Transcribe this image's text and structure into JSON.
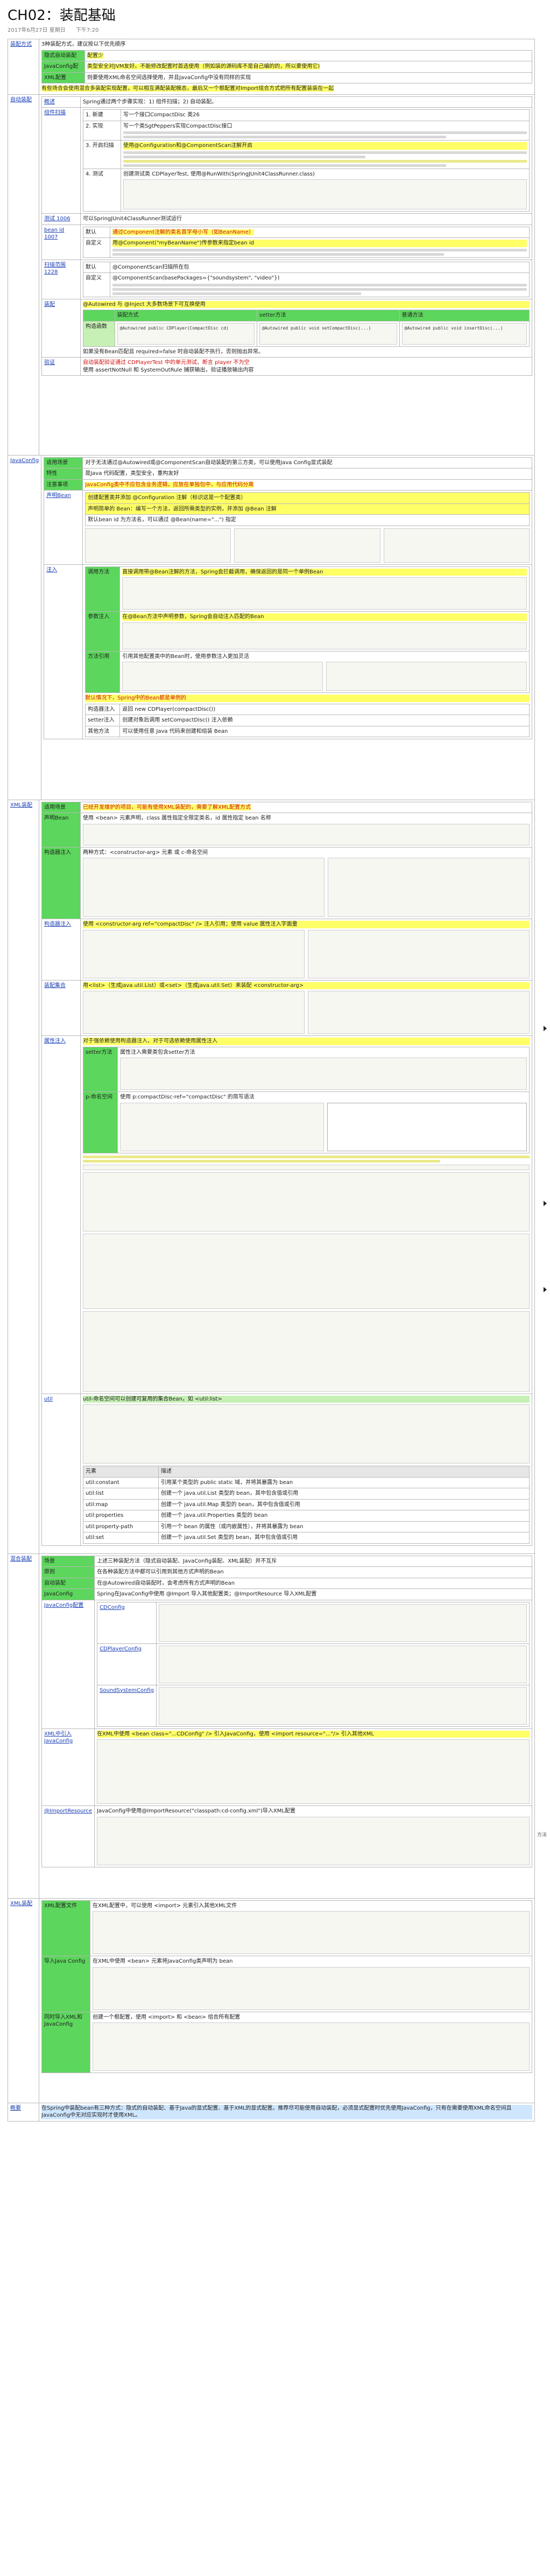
{
  "doc": {
    "title": "CH02：装配基础",
    "date": "2017年6月27日 星期日",
    "time": "下午7:20"
  },
  "sections": {
    "assembly": {
      "label": "装配方式",
      "intro": "3种装配方式，建议按以下优先顺序",
      "rows": [
        {
          "label": "隐式自动装配",
          "text": "配置少"
        },
        {
          "label": "JavaConfig配",
          "text": "类型安全对JVM友好。不能修改配置时首选使用（例如装的源码库不是自己编的的，所以要使用它)"
        },
        {
          "label": "XML配置",
          "text": "则要使用XML命名空间选择使用，并且JavaConfig中没有同样的实现"
        }
      ],
      "note": "有些场合会使用混合多装配实现配置，可以相互满配装配模态，最后又一个根配置对Import组合方式把所有配置装装在一起"
    },
    "auto": {
      "label": "自动装配",
      "overview_label": "概述",
      "overview_text": "Spring通过两个步骤实现：1) 组件扫描；2) 自动装配。",
      "scan_label": "组件扫描",
      "steps": [
        {
          "n": "1. 新建",
          "t": "写一个接口CompactDisc 类26"
        },
        {
          "n": "2. 实现",
          "t": "写一个类SgtPeppers实现CompactDisc接口"
        },
        {
          "n": "3. 开启扫描",
          "t": "使用@Configuration和@ComponentScan注解开启"
        },
        {
          "n": "4. 测试",
          "t": "创建测试类 CDPlayerTest, 使用@RunWith(SpringJUnit4ClassRunner.class)"
        }
      ],
      "test_row": "测试 1006",
      "test_text": "可以SpringJUnit4ClassRunner测试运行",
      "bean_id_label": "bean id 1007",
      "bean_rows": [
        {
          "k": "默认",
          "v": "通过Component注解的类名首字母小写（如BeanName）"
        },
        {
          "k": "自定义",
          "v": "用@Component(\"myBeanName\")传参数来指定bean id"
        }
      ],
      "base_label": "扫描范围 1228",
      "base_rows": [
        {
          "k": "默认",
          "v": "@ComponentScan扫描所在包"
        },
        {
          "k": "自定义",
          "v": "@ComponentScan(basePackages={\"soundsystem\", \"video\"})"
        }
      ],
      "wire_label": "装配",
      "wire_table_headers": [
        "装配方式",
        "setter方法",
        "普通方法"
      ],
      "wire_table_row": [
        "构造函数",
        "@Autowired public CDPlayer(CompactDisc cd)",
        "@Autowired public void setCompactDisc(...)",
        "@Autowired public void insertDisc(...)"
      ],
      "wire_note": "如果没有Bean匹配且 required=false 时自动装配不执行，否则抛出异常。",
      "wire_note2": "@Autowired 与 @Inject 大多数场景下可互换使用",
      "check_label": "验证",
      "check_text": "自动装配验证通过 CDPlayerTest 中的单元测试，断言 player 不为空",
      "check_text2": "使用 assertNotNull 和 SystemOutRule 捕获输出，验证播放输出内容"
    },
    "java": {
      "label": "JavaConfig",
      "rows": [
        {
          "k": "适用场景",
          "v": "对于无法通过@Autowired或@ComponentScan自动装配的第三方类，可以使用Java Config显式装配"
        },
        {
          "k": "特性",
          "v": "是Java 代码配置，类型安全，重构友好"
        },
        {
          "k": "注意事项",
          "v": "JavaConfig类中不应包含业务逻辑，应放在单独包中，与应用代码分离"
        }
      ],
      "declare_label": "声明Bean",
      "declare_steps": [
        "创建配置类并添加 @Configuration 注解（标识这是一个配置类）",
        "声明简单的 Bean：编写一个方法，返回所需类型的实例，并添加 @Bean 注解",
        "默认bean id 为方法名，可以通过 @Bean(name=\"...\") 指定"
      ],
      "inject_label": "注入",
      "inject_rows": [
        {
          "k": "调用方法",
          "v": "直接调用带@Bean注解的方法，Spring会拦截调用，确保返回的是同一个单例Bean"
        },
        {
          "k": "参数注入",
          "v": "在@Bean方法中声明参数，Spring会自动注入匹配的Bean"
        },
        {
          "k": "方法引用",
          "v": "引用其他配置类中的Bean时，使用参数注入更加灵活"
        }
      ],
      "single_note": "默认情况下，Spring中的Bean都是单例的",
      "summary_rows": [
        {
          "k": "构造器注入",
          "v": "返回 new CDPlayer(compactDisc())"
        },
        {
          "k": "setter注入",
          "v": "创建对象后调用 setCompactDisc() 注入依赖"
        },
        {
          "k": "其他方法",
          "v": "可以使用任意 Java 代码来创建和组装 Bean"
        }
      ]
    },
    "xml": {
      "label": "XML装配",
      "rows": [
        {
          "k": "适用场景",
          "v": "已经开发维护的项目，可能有使用XML装配的，需要了解XML配置方式"
        },
        {
          "k": "声明Bean",
          "v": "使用 <bean> 元素声明，class 属性指定全限定类名，id 属性指定 bean 名称"
        },
        {
          "k": "构造器注入",
          "v": "两种方式：<constructor-arg> 元素 或 c-命名空间"
        }
      ],
      "ctor_label": "构造器注入",
      "ctor_text": "使用 <constructor-arg ref=\"compactDisc\" /> 注入引用；使用 value 属性注入字面量",
      "ctor_list_label": "装配集合",
      "ctor_list_text": "用<list>（生成java.util.List）或<set>（生成java.util.Set）来装配 <constructor-arg>",
      "prop_label": "属性注入",
      "prop_text": "对于强依赖使用构造器注入，对于可选依赖使用属性注入",
      "setter_label": "setter方法",
      "setter_text": "属性注入需要类包含setter方法",
      "p_label": "p-命名空间",
      "p_text": "使用 p:compactDisc-ref=\"compactDisc\" 的简写语法",
      "util_label": "util",
      "util_text": "util-命名空间可以创建可复用的集合Bean，如 <util:list>",
      "util_headers": [
        "元素",
        "描述"
      ],
      "util_rows": [
        [
          "util:constant",
          "引用某个类型的 public static 域，并将其暴露为 bean"
        ],
        [
          "util:list",
          "创建一个 java.util.List 类型的 bean，其中包含值或引用"
        ],
        [
          "util:map",
          "创建一个 java.util.Map 类型的 bean，其中包含值或引用"
        ],
        [
          "util:properties",
          "创建一个 java.util.Properties 类型的 bean"
        ],
        [
          "util:property-path",
          "引用一个 bean 的属性（或内嵌属性），并将其暴露为 bean"
        ],
        [
          "util:set",
          "创建一个 java.util.Set 类型的 bean，其中包含值或引用"
        ]
      ]
    },
    "mixed": {
      "label": "混合装配",
      "rows": [
        {
          "k": "场景",
          "v": "上述三种装配方法（隐式自动装配、JavaConfig装配、XML装配）并不互斥"
        },
        {
          "k": "原则",
          "v": "在各种装配方法中都可以引用到其他方式声明的Bean"
        },
        {
          "k": "自动装配",
          "v": "在@Autowired自动装配时，会考虑所有方式声明的Bean"
        },
        {
          "k": "JavaConfig",
          "v": "Spring在JavaConfig中使用 @Import 导入其他配置类；@ImportResource 导入XML配置"
        }
      ],
      "jc_label": "JavaConfig配置",
      "jc_sub": [
        "CDConfig",
        "CDPlayerConfig",
        "SoundSystemConfig"
      ],
      "xml_label": "XML中引入JavaConfig",
      "xml_text": "在XML中使用 <bean class=\"...CDConfig\" /> 引入JavaConfig，使用 <import resource=\"...\"/> 引入其他XML",
      "import_label": "@ImportResource",
      "import_text": "JavaConfig中使用@ImportResource(\"classpath:cd-config.xml\")导入XML配置"
    },
    "xmlmix": {
      "label": "XML装配",
      "rows": [
        {
          "k": "XML配置文件",
          "v": "在XML配置中，可以使用 <import> 元素引入其他XML文件"
        },
        {
          "k": "导入Java Config",
          "v": "在XML中使用 <bean> 元素将JavaConfig类声明为 bean"
        },
        {
          "k": "同时导入XML和JavaConfig",
          "v": "创建一个根配置，使用 <import> 和 <bean> 组合所有配置"
        }
      ]
    },
    "summary": {
      "label": "概要",
      "text": "在Spring中装配bean有三种方式：隐式的自动装配、基于Java的显式配置、基于XML的显式配置。推荐尽可能使用自动装配，必须显式配置时优先使用JavaConfig，只有在需要使用XML命名空间且JavaConfig中无对应实现时才使用XML。"
    }
  },
  "side": {
    "note_label": "方法"
  }
}
